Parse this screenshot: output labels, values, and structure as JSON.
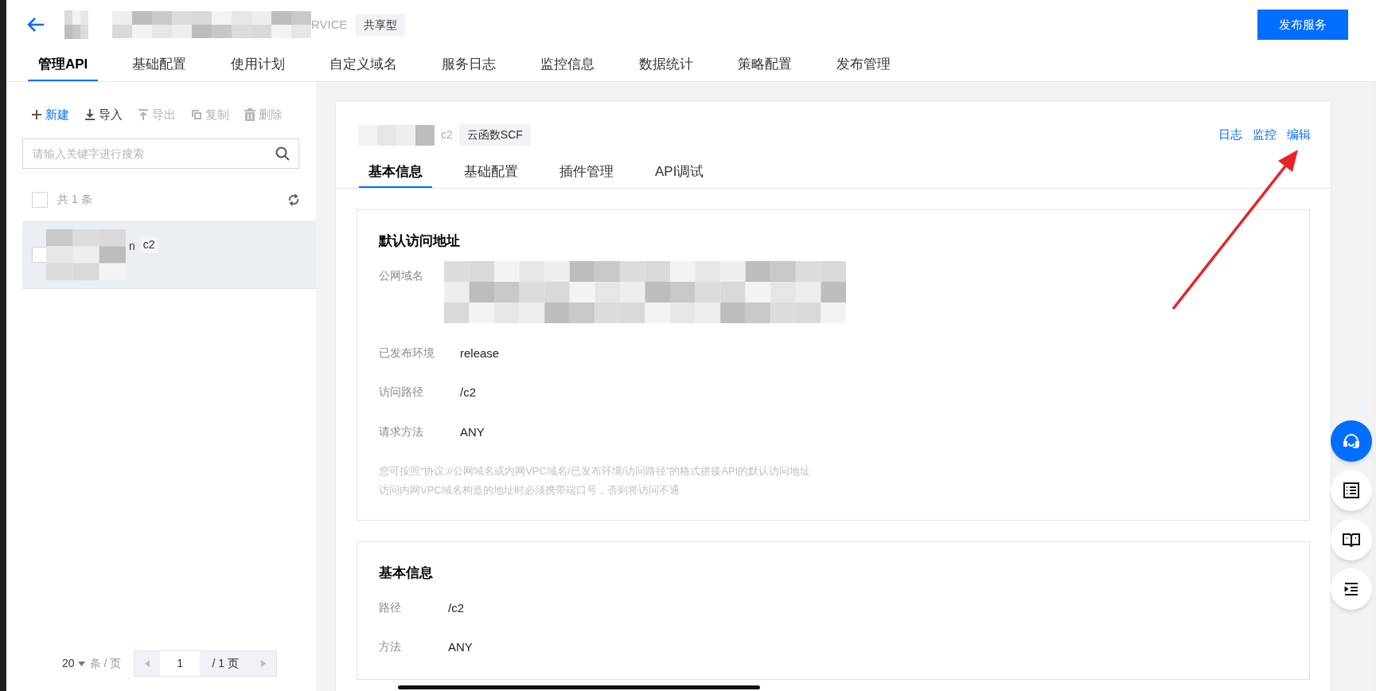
{
  "header": {
    "service_suffix": "RVICE",
    "type_tag": "共享型",
    "publish_button": "发布服务"
  },
  "main_tabs": [
    {
      "label": "管理API",
      "selected": true
    },
    {
      "label": "基础配置",
      "selected": false
    },
    {
      "label": "使用计划",
      "selected": false
    },
    {
      "label": "自定义域名",
      "selected": false
    },
    {
      "label": "服务日志",
      "selected": false
    },
    {
      "label": "监控信息",
      "selected": false
    },
    {
      "label": "数据统计",
      "selected": false
    },
    {
      "label": "策略配置",
      "selected": false
    },
    {
      "label": "发布管理",
      "selected": false
    }
  ],
  "toolbar": [
    {
      "kind": "plus",
      "label": "新建",
      "disabled": false,
      "primary": true
    },
    {
      "kind": "import",
      "label": "导入",
      "disabled": false,
      "primary": false
    },
    {
      "kind": "export",
      "label": "导出",
      "disabled": true,
      "primary": false
    },
    {
      "kind": "copy",
      "label": "复制",
      "disabled": true,
      "primary": false
    },
    {
      "kind": "trash",
      "label": "删除",
      "disabled": true,
      "primary": false
    }
  ],
  "search": {
    "placeholder": "请输入关键字进行搜索"
  },
  "list": {
    "select_all_checked": false,
    "total": "共 1 条",
    "items": [
      {
        "name_suffix": "n",
        "tag": "c2",
        "checked": false,
        "selected": true
      }
    ]
  },
  "pagination": {
    "page_size": "20",
    "per_page_label": "条 / 页",
    "page": "1",
    "total_pages": "/ 1 页"
  },
  "detail": {
    "name_tag": "c2",
    "backend_tag": "云函数SCF",
    "actions": [
      "日志",
      "监控",
      "编辑"
    ],
    "tabs": [
      {
        "label": "基本信息",
        "selected": true
      },
      {
        "label": "基础配置",
        "selected": false
      },
      {
        "label": "插件管理",
        "selected": false
      },
      {
        "label": "API调试",
        "selected": false
      }
    ],
    "sections": [
      {
        "title": "默认访问地址",
        "rows": [
          {
            "kind": "redacted",
            "label": "公网域名"
          },
          {
            "kind": "text",
            "label": "已发布环境",
            "value": "release"
          },
          {
            "kind": "text",
            "label": "访问路径",
            "value": "/c2"
          },
          {
            "kind": "text",
            "label": "请求方法",
            "value": "ANY"
          }
        ],
        "notes": [
          "您可按照“协议://公网域名或内网VPC域名/已发布环境/访问路径”的格式拼接API的默认访问地址",
          "访问内网VPC域名构造的地址时必须携带端口号，否则将访问不通"
        ]
      },
      {
        "title": "基本信息",
        "rows": [
          {
            "kind": "text",
            "label": "路径",
            "value": "/c2"
          },
          {
            "kind": "text",
            "label": "方法",
            "value": "ANY"
          }
        ]
      }
    ]
  },
  "float_buttons": [
    {
      "kind": "headset",
      "selected": true
    },
    {
      "kind": "list",
      "selected": false
    },
    {
      "kind": "book",
      "selected": false
    },
    {
      "kind": "outline",
      "selected": false
    }
  ]
}
